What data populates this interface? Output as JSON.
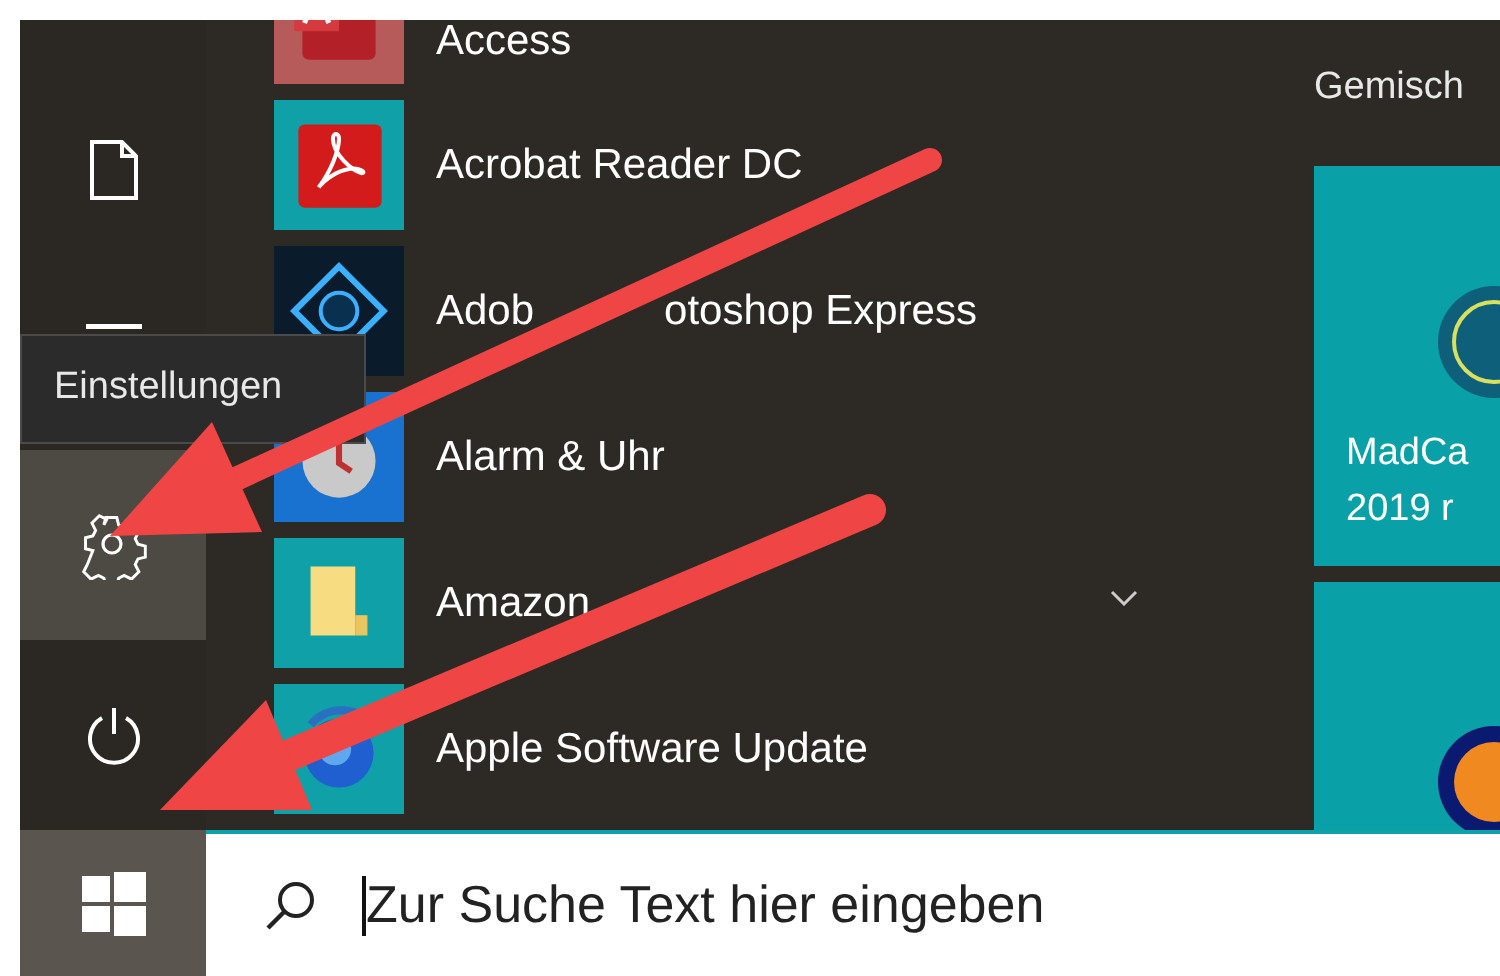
{
  "rail": [
    {
      "kind": "document",
      "highlighted": false
    },
    {
      "kind": "partial",
      "highlighted": false
    },
    {
      "kind": "settings",
      "highlighted": true
    },
    {
      "kind": "power",
      "highlighted": false
    }
  ],
  "tooltip": "Einstellungen",
  "apps": [
    {
      "name": "Access",
      "kind": "access"
    },
    {
      "name": "Acrobat Reader DC",
      "kind": "acrobat"
    },
    {
      "name": [
        "Adob",
        "otoshop Express"
      ],
      "kind": "photoshop"
    },
    {
      "name": "Alarm & Uhr",
      "kind": "alarm"
    },
    {
      "name": "Amazon",
      "kind": "folder",
      "expanded": false
    },
    {
      "name": "Apple Software Update",
      "kind": "update"
    }
  ],
  "tile_group": {
    "title": "Gemisch",
    "tiles": [
      {
        "lines": [
          "MadCa",
          "2019 r"
        ],
        "kind": "madcap"
      },
      {
        "kind": "orange"
      }
    ]
  },
  "start_button": {
    "highlighted": true
  },
  "search": {
    "placeholder": "Zur Suche Text hier eingeben"
  }
}
